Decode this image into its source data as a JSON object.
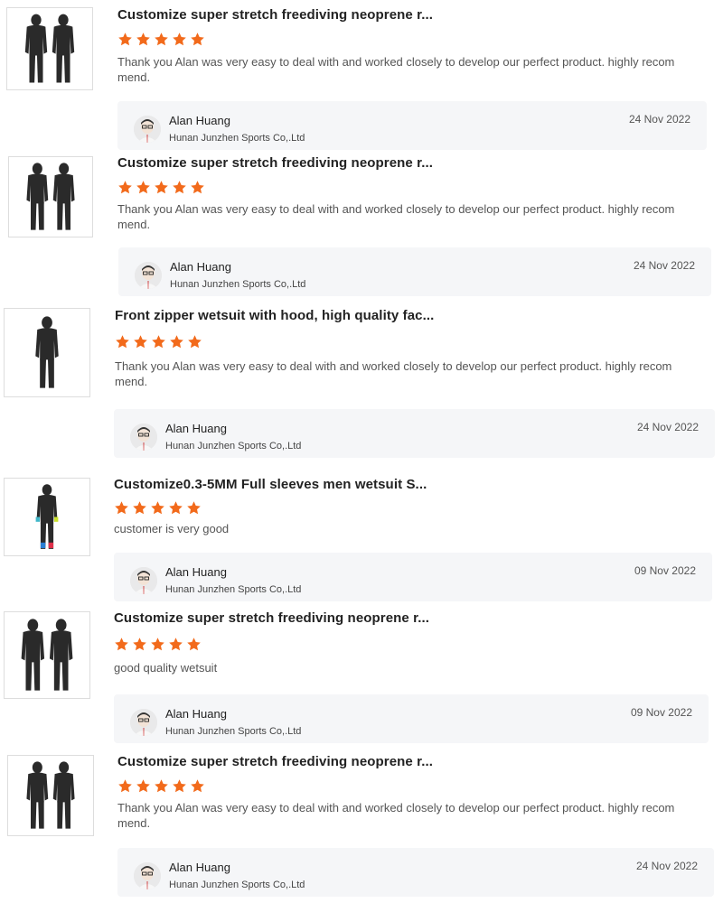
{
  "reviews": [
    {
      "title": "Customize super stretch freediving neoprene r...",
      "rating": 5,
      "text": "Thank you Alan was very easy to deal with and worked closely to develop our perfect product. highly recom mend.",
      "image": "two-hooded-wetsuits",
      "reply": {
        "name": "Alan Huang",
        "company": "Hunan Junzhen Sports Co,.Ltd",
        "date": "24 Nov 2022"
      }
    },
    {
      "title": "Customize super stretch freediving neoprene r...",
      "rating": 5,
      "text": "Thank you Alan was very easy to deal with and worked closely to develop our perfect product. highly recom mend.",
      "image": "two-hooded-wetsuits",
      "reply": {
        "name": "Alan Huang",
        "company": "Hunan Junzhen Sports Co,.Ltd",
        "date": "24 Nov 2022"
      }
    },
    {
      "title": "Front zipper wetsuit with hood, high quality fac...",
      "rating": 5,
      "text": "Thank you Alan was very easy to deal with and worked closely to develop our perfect product. highly recom mend.",
      "image": "single-hooded-wetsuit",
      "reply": {
        "name": "Alan Huang",
        "company": "Hunan Junzhen Sports Co,.Ltd",
        "date": "24 Nov 2022"
      }
    },
    {
      "title": "Customize0.3-5MM Full sleeves men wetsuit S...",
      "rating": 5,
      "text": "customer is very good",
      "image": "colorful-full-wetsuit",
      "reply": {
        "name": "Alan Huang",
        "company": "Hunan Junzhen Sports Co,.Ltd",
        "date": "09 Nov 2022"
      }
    },
    {
      "title": "Customize super stretch freediving neoprene r...",
      "rating": 5,
      "text": "good quality wetsuit",
      "image": "two-hooded-wetsuits",
      "reply": {
        "name": "Alan Huang",
        "company": "Hunan Junzhen Sports Co,.Ltd",
        "date": "09 Nov 2022"
      }
    },
    {
      "title": "Customize super stretch freediving neoprene r...",
      "rating": 5,
      "text": "Thank you Alan was very easy to deal with and worked closely to develop our perfect product. highly recom mend.",
      "image": "two-hooded-wetsuits",
      "reply": {
        "name": "Alan Huang",
        "company": "Hunan Junzhen Sports Co,.Ltd",
        "date": "24 Nov 2022"
      }
    }
  ],
  "colors": {
    "star": "#f26a1b",
    "reply_bg": "#f5f6f8",
    "wetsuit": "#2a2a2a"
  },
  "icons": {
    "rating": "star-icon",
    "avatar": "reviewer-avatar"
  }
}
